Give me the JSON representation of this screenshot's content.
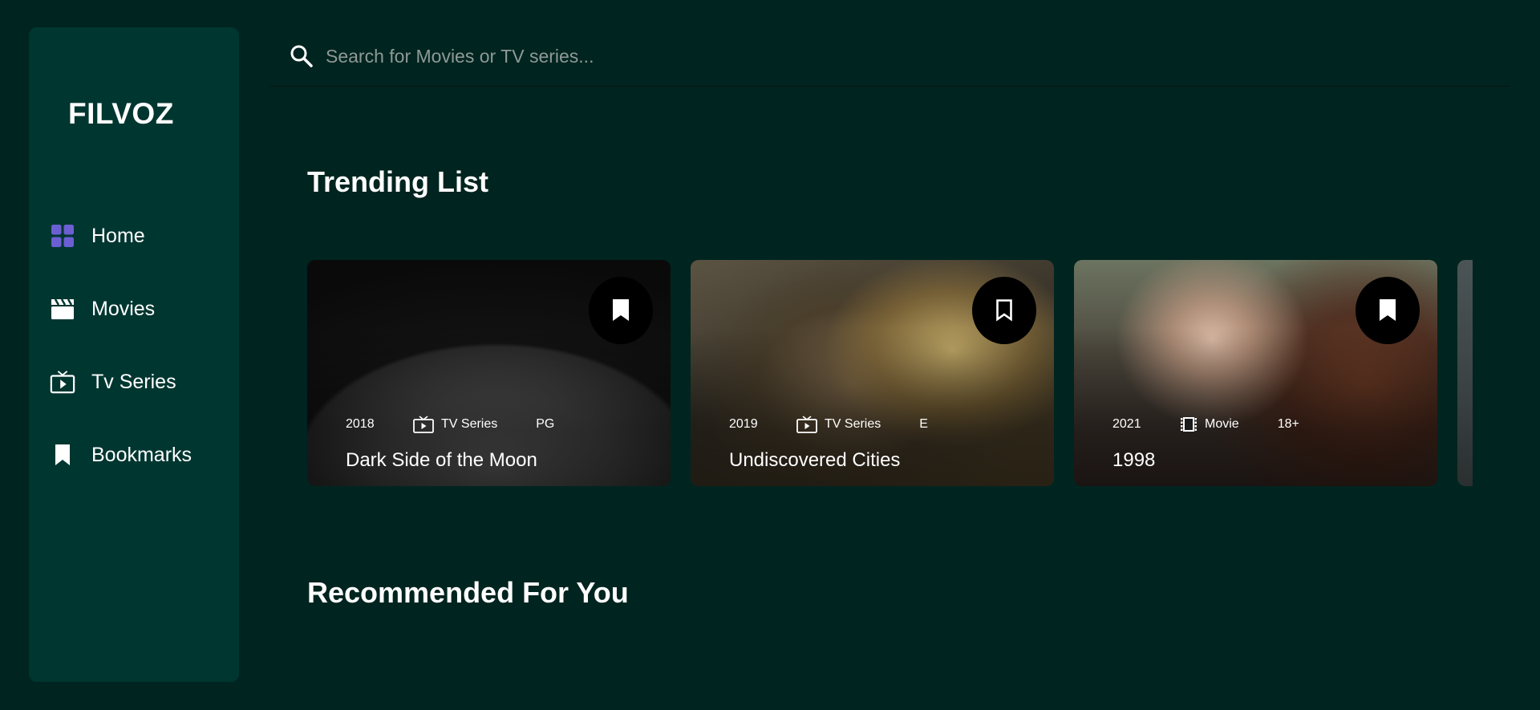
{
  "app": {
    "logo": "FILVOZ"
  },
  "sidebar": {
    "items": [
      {
        "label": "Home",
        "icon": "grid-icon",
        "active": true,
        "color": "#6b5fd3"
      },
      {
        "label": "Movies",
        "icon": "clapperboard-icon"
      },
      {
        "label": "Tv Series",
        "icon": "tv-icon"
      },
      {
        "label": "Bookmarks",
        "icon": "bookmark-icon"
      }
    ]
  },
  "search": {
    "placeholder": "Search for Movies or TV series...",
    "value": ""
  },
  "sections": {
    "trending": "Trending List",
    "recommended": "Recommended For You"
  },
  "trending": [
    {
      "year": "2018",
      "type": "TV Series",
      "type_icon": "tv-icon",
      "rating": "PG",
      "title": "Dark Side of the Moon"
    },
    {
      "year": "2019",
      "type": "TV Series",
      "type_icon": "tv-icon",
      "rating": "E",
      "title": "Undiscovered Cities"
    },
    {
      "year": "2021",
      "type": "Movie",
      "type_icon": "film-icon",
      "rating": "18+",
      "title": "1998"
    }
  ],
  "colors": {
    "background": "#00241f",
    "sidebar": "#003630",
    "accent": "#6b5fd3"
  }
}
